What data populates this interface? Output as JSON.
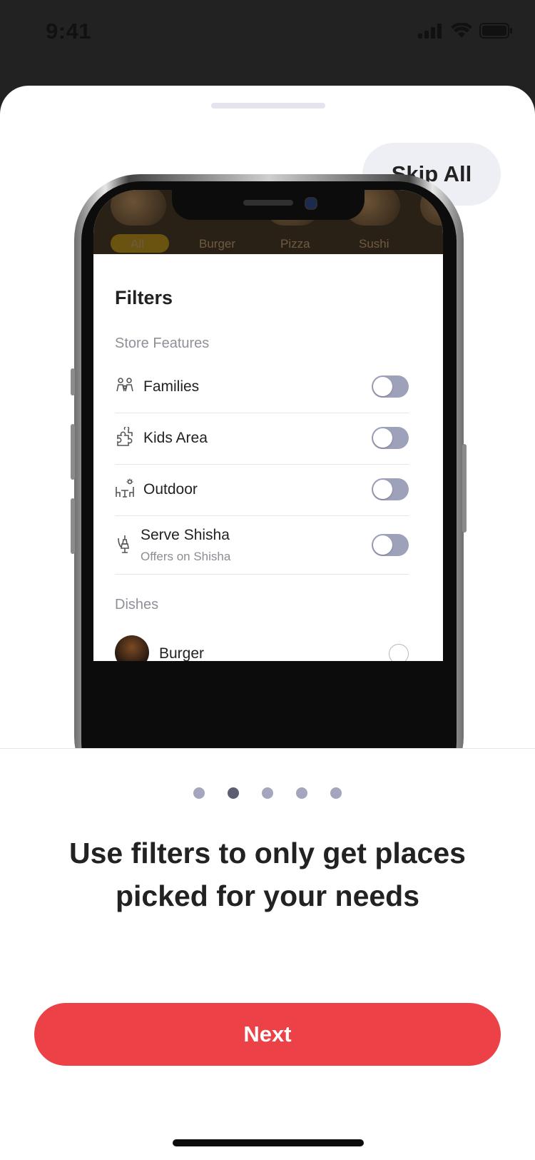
{
  "status_bar": {
    "time": "9:41"
  },
  "sheet": {
    "skip_label": "Skip All"
  },
  "preview": {
    "categories": [
      "All",
      "Burger",
      "Pizza",
      "Sushi"
    ],
    "filters_title": "Filters",
    "store_features_label": "Store Features",
    "features": [
      {
        "label": "Families",
        "icon": "families-icon",
        "enabled": false
      },
      {
        "label": "Kids Area",
        "icon": "puzzle-icon",
        "enabled": false
      },
      {
        "label": "Outdoor",
        "icon": "outdoor-table-icon",
        "enabled": false
      },
      {
        "label": "Serve Shisha",
        "sublabel": "Offers on Shisha",
        "icon": "shisha-icon",
        "enabled": false
      }
    ],
    "dishes_label": "Dishes",
    "dish_first": "Burger"
  },
  "onboarding": {
    "page_count": 5,
    "active_page": 2,
    "headline": "Use filters to only get places picked for your needs",
    "next_label": "Next"
  },
  "colors": {
    "accent": "#ec4146",
    "toggle_off": "#9ea1ba",
    "dot_inactive": "#a3a6bd",
    "dot_active": "#5c5f73"
  }
}
